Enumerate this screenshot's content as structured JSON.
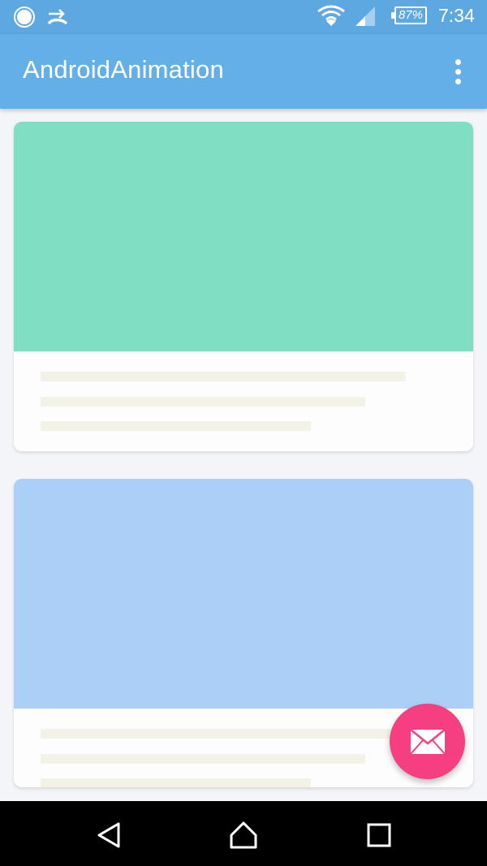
{
  "status_bar": {
    "icons": [
      "circle-notification-icon",
      "call-transfer-icon",
      "wifi-icon",
      "signal-icon",
      "battery-icon"
    ],
    "battery_percent": "87%",
    "time": "7:34"
  },
  "app_bar": {
    "title": "AndroidAnimation",
    "menu_icon": "overflow-menu-icon"
  },
  "cards": [
    {
      "media_color": "#80dfc3",
      "placeholder_lines": 3
    },
    {
      "media_color": "#accff8",
      "placeholder_lines": 3
    }
  ],
  "fab": {
    "icon": "mail-icon",
    "color": "#f53f80"
  },
  "nav_bar": {
    "icons": [
      "back-icon",
      "home-icon",
      "recents-icon"
    ]
  }
}
